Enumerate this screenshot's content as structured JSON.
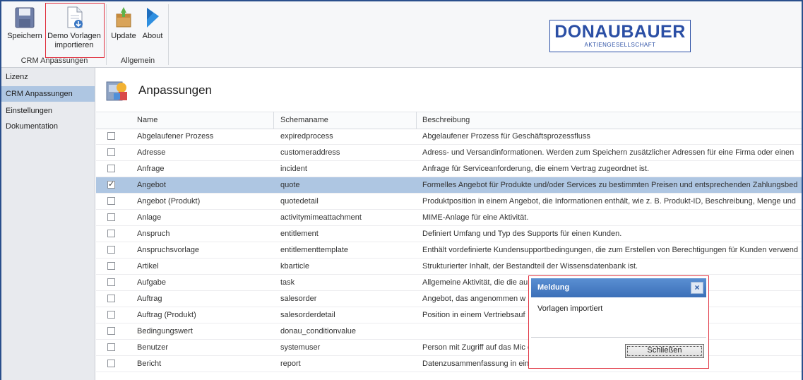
{
  "ribbon": {
    "save_label": "Speichern",
    "demo_label_1": "Demo Vorlagen",
    "demo_label_2": "importieren",
    "update_label": "Update",
    "about_label": "About",
    "group1_label": "CRM Anpassungen",
    "group2_label": "Allgemein"
  },
  "logo": {
    "name": "DONAUBAUER",
    "subtitle": "AKTIENGESELLSCHAFT",
    "color": "#2b4fa5"
  },
  "nav": {
    "items": [
      {
        "label": "Lizenz"
      },
      {
        "label": "CRM Anpassungen"
      },
      {
        "label": "Einstellungen"
      },
      {
        "label": "Dokumentation"
      }
    ],
    "selected": "CRM Anpassungen"
  },
  "main": {
    "title": "Anpassungen",
    "columns": {
      "name": "Name",
      "schema": "Schemaname",
      "desc": "Beschreibung"
    },
    "rows": [
      {
        "name": "Abgelaufener Prozess",
        "schema": "expiredprocess",
        "desc": "Abgelaufener Prozess für Geschäftsprozessfluss",
        "checked": false
      },
      {
        "name": "Adresse",
        "schema": "customeraddress",
        "desc": "Adress- und Versandinformationen. Werden zum Speichern zusätzlicher Adressen für eine Firma oder einen",
        "checked": false
      },
      {
        "name": "Anfrage",
        "schema": "incident",
        "desc": "Anfrage für Serviceanforderung, die einem Vertrag zugeordnet ist.",
        "checked": false
      },
      {
        "name": "Angebot",
        "schema": "quote",
        "desc": "Formelles Angebot für Produkte und/oder Services zu bestimmten Preisen und entsprechenden Zahlungsbed",
        "checked": true
      },
      {
        "name": "Angebot (Produkt)",
        "schema": "quotedetail",
        "desc": "Produktposition in einem Angebot, die Informationen enthält, wie z. B. Produkt-ID, Beschreibung, Menge und",
        "checked": false
      },
      {
        "name": "Anlage",
        "schema": "activitymimeattachment",
        "desc": "MIME-Anlage für eine Aktivität.",
        "checked": false
      },
      {
        "name": "Anspruch",
        "schema": "entitlement",
        "desc": "Definiert Umfang und Typ des Supports für einen Kunden.",
        "checked": false
      },
      {
        "name": "Anspruchsvorlage",
        "schema": "entitlementtemplate",
        "desc": "Enthält vordefinierte Kundensupportbedingungen, die zum Erstellen von Berechtigungen für Kunden verwend",
        "checked": false
      },
      {
        "name": "Artikel",
        "schema": "kbarticle",
        "desc": "Strukturierter Inhalt, der Bestandteil der Wissensdatenbank ist.",
        "checked": false
      },
      {
        "name": "Aufgabe",
        "schema": "task",
        "desc": "Allgemeine Aktivität, die die au",
        "checked": false
      },
      {
        "name": "Auftrag",
        "schema": "salesorder",
        "desc": "Angebot, das angenommen w",
        "checked": false
      },
      {
        "name": "Auftrag (Produkt)",
        "schema": "salesorderdetail",
        "desc": "Position in einem Vertriebsauf",
        "checked": false
      },
      {
        "name": "Bedingungswert",
        "schema": "donau_conditionvalue",
        "desc": "",
        "checked": false
      },
      {
        "name": "Benutzer",
        "schema": "systemuser",
        "desc": "Person mit Zugriff auf das Mic                                                          er Microsoft CRM-Datenba",
        "checked": false
      },
      {
        "name": "Bericht",
        "schema": "report",
        "desc": "Datenzusammenfassung in einem leicht lesbaren Layout.",
        "checked": false
      }
    ]
  },
  "dialog": {
    "title": "Meldung",
    "close": "×",
    "message": "Vorlagen importiert",
    "button": "Schließen"
  },
  "colors": {
    "accent": "#3b6fb8",
    "selection": "#aec6e2",
    "highlight": "#e0313f"
  }
}
